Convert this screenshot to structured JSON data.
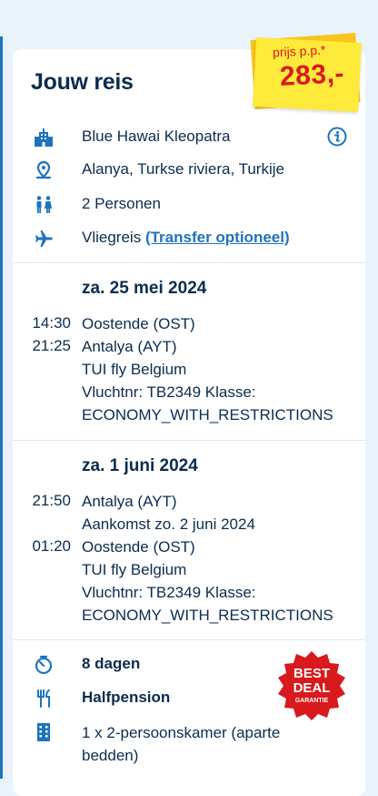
{
  "panel": {
    "title": "Jouw reis"
  },
  "price": {
    "label": "prijs p.p.*",
    "value": "283,-"
  },
  "trip": {
    "hotel": "Blue Hawai Kleopatra",
    "location": "Alanya, Turkse riviera, Turkije",
    "persons": "2 Personen",
    "travel_prefix": "Vliegreis",
    "transfer_link": "(Transfer optioneel)"
  },
  "outbound": {
    "date": "za. 25 mei 2024",
    "dep_time": "14:30",
    "dep_airport": "Oostende (OST)",
    "arr_time": "21:25",
    "arr_airport": "Antalya (AYT)",
    "carrier": "TUI fly Belgium",
    "flight_info": "Vluchtnr: TB2349 Klasse:",
    "class": "ECONOMY_WITH_RESTRICTIONS"
  },
  "return": {
    "date": "za. 1 juni 2024",
    "dep_time": "21:50",
    "dep_airport": "Antalya (AYT)",
    "arrival_note": "Aankomst zo. 2 juni 2024",
    "arr_time": "01:20",
    "arr_airport": "Oostende (OST)",
    "carrier": "TUI fly Belgium",
    "flight_info": "Vluchtnr: TB2349 Klasse:",
    "class": "ECONOMY_WITH_RESTRICTIONS"
  },
  "stay": {
    "duration": "8 dagen",
    "board": "Halfpension",
    "room_line1": "1 x 2-persoonskamer (aparte",
    "room_line2": "bedden)"
  },
  "badge": {
    "line1": "BEST",
    "line2": "DEAL",
    "line3": "GARANTIE"
  },
  "colors": {
    "accent": "#1e73be",
    "price": "#d8191d",
    "sticker": "#fdea3a",
    "text": "#0b2c4e"
  }
}
